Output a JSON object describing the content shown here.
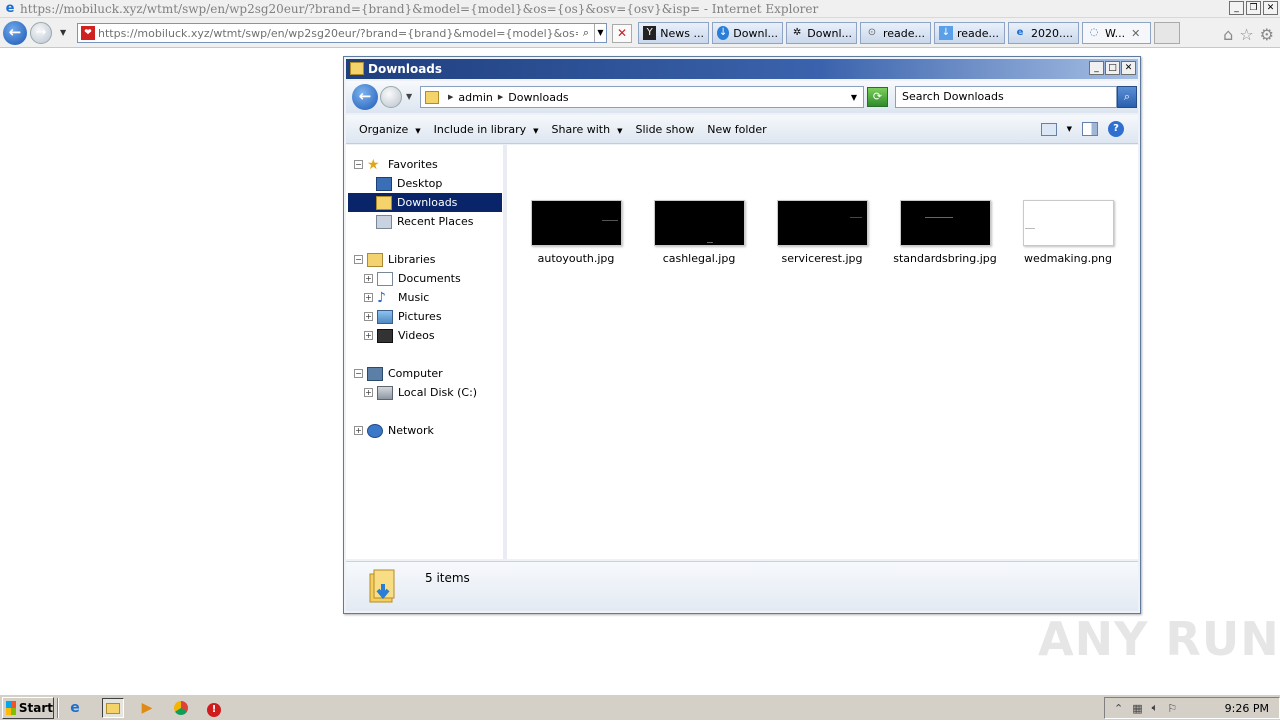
{
  "browser": {
    "title": "https://mobiluck.xyz/wtmt/swp/en/wp2sg20eur/?brand={brand}&model={model}&os={os}&osv={osv}&isp= - Internet Explorer",
    "address_host": "https://mobiluck.xyz",
    "address_path": "/wtmt/swp/en/wp2sg20eur/?brand={brand}&model={model}&os={os}&osv=",
    "tabs": [
      {
        "label": "News ...",
        "icon": "y-icon"
      },
      {
        "label": "Downl...",
        "icon": "download-icon"
      },
      {
        "label": "Downl...",
        "icon": "wheel-icon"
      },
      {
        "label": "reade...",
        "icon": "reader-icon"
      },
      {
        "label": "reade...",
        "icon": "download-arrow-icon"
      },
      {
        "label": "2020....",
        "icon": "ie-icon"
      },
      {
        "label": "W...",
        "icon": "loading-icon",
        "active": true
      }
    ]
  },
  "explorer": {
    "title": "Downloads",
    "breadcrumb": [
      "admin",
      "Downloads"
    ],
    "search_placeholder": "Search Downloads",
    "commands": [
      "Organize",
      "Include in library",
      "Share with",
      "Slide show",
      "New folder"
    ],
    "tree": {
      "favorites": "Favorites",
      "desktop": "Desktop",
      "downloads": "Downloads",
      "recent": "Recent Places",
      "libraries": "Libraries",
      "documents": "Documents",
      "music": "Music",
      "pictures": "Pictures",
      "videos": "Videos",
      "computer": "Computer",
      "local_disk": "Local Disk (C:)",
      "network": "Network"
    },
    "files": [
      {
        "name": "autoyouth.jpg",
        "thumb": "dark"
      },
      {
        "name": "cashlegal.jpg",
        "thumb": "dark"
      },
      {
        "name": "servicerest.jpg",
        "thumb": "dark"
      },
      {
        "name": "standardsbring.jpg",
        "thumb": "dark"
      },
      {
        "name": "wedmaking.png",
        "thumb": "light"
      }
    ],
    "status": "5 items"
  },
  "watermark": "ANY RUN",
  "taskbar": {
    "start_label": "Start",
    "clock": "9:26 PM"
  }
}
